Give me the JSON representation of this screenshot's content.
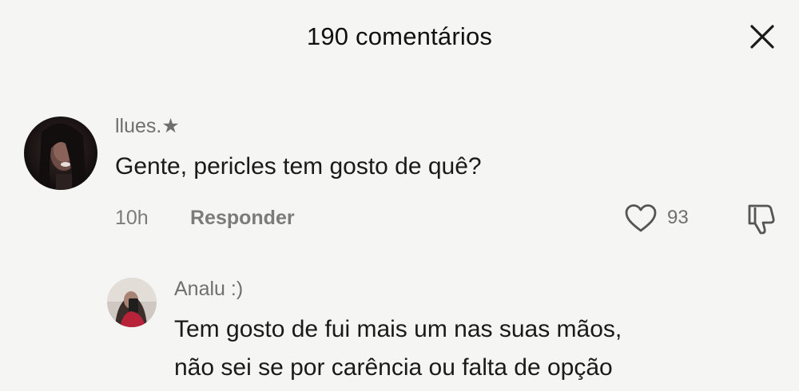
{
  "header": {
    "title": "190 comentários",
    "close_icon": "close-icon"
  },
  "comments": [
    {
      "username": "llues.★",
      "text": "Gente, pericles tem gosto de quê?",
      "time": "10h",
      "reply_label": "Responder",
      "likes": "93",
      "avatar_icon": "avatar-image",
      "like_icon": "heart-outline-icon",
      "dislike_icon": "thumbs-down-icon"
    }
  ],
  "reply": {
    "username": "Analu :)",
    "text_lines": [
      "Tem gosto de fui mais um nas suas mãos,",
      "não sei se por carência ou falta de opção"
    ],
    "avatar_icon": "avatar-image"
  },
  "colors": {
    "background": "#f5f5f4",
    "text_primary": "#1a1a1a",
    "text_secondary": "#6f6f6f"
  }
}
